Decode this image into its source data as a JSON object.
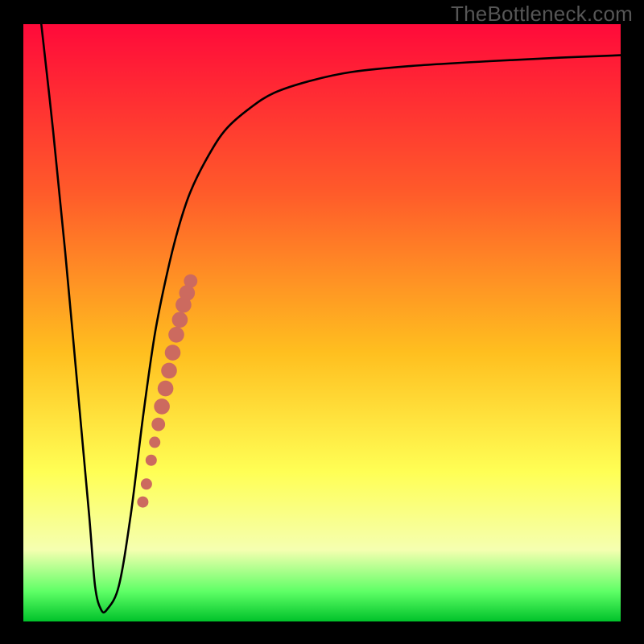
{
  "watermark": "TheBottleneck.com",
  "colors": {
    "top": "#ff0a3a",
    "mid_top": "#ff5a2a",
    "mid": "#ffbf1f",
    "mid_low": "#ffff55",
    "low": "#f5ffb0",
    "very_low": "#5eff66",
    "bottom_line": "#00c22a",
    "curve": "#000000",
    "markers": "#cc6a5f",
    "border": "#000000"
  },
  "chart_data": {
    "type": "line",
    "title": "",
    "xlabel": "",
    "ylabel": "",
    "xlim": [
      0,
      100
    ],
    "ylim": [
      0,
      100
    ],
    "series": [
      {
        "name": "bottleneck-curve",
        "x": [
          3,
          5,
          7,
          9,
          11,
          12,
          13,
          14,
          16,
          18,
          20,
          22,
          24,
          26,
          28,
          31,
          34,
          38,
          42,
          48,
          55,
          65,
          78,
          90,
          100
        ],
        "y": [
          100,
          82,
          62,
          40,
          18,
          6,
          2,
          2,
          6,
          18,
          34,
          48,
          58,
          66,
          72,
          78,
          82.5,
          86,
          88.5,
          90.5,
          92,
          93,
          93.8,
          94.4,
          94.8
        ]
      }
    ],
    "markers": {
      "name": "highlight-segment",
      "points": [
        {
          "x": 20.0,
          "y": 20.0,
          "r": 1.0
        },
        {
          "x": 20.6,
          "y": 23.0,
          "r": 1.0
        },
        {
          "x": 21.4,
          "y": 27.0,
          "r": 1.0
        },
        {
          "x": 22.0,
          "y": 30.0,
          "r": 1.0
        },
        {
          "x": 22.6,
          "y": 33.0,
          "r": 1.2
        },
        {
          "x": 23.2,
          "y": 36.0,
          "r": 1.4
        },
        {
          "x": 23.8,
          "y": 39.0,
          "r": 1.4
        },
        {
          "x": 24.4,
          "y": 42.0,
          "r": 1.4
        },
        {
          "x": 25.0,
          "y": 45.0,
          "r": 1.4
        },
        {
          "x": 25.6,
          "y": 48.0,
          "r": 1.4
        },
        {
          "x": 26.2,
          "y": 50.5,
          "r": 1.4
        },
        {
          "x": 26.8,
          "y": 53.0,
          "r": 1.4
        },
        {
          "x": 27.4,
          "y": 55.0,
          "r": 1.4
        },
        {
          "x": 28.0,
          "y": 57.0,
          "r": 1.2
        }
      ]
    },
    "gradient_bands": [
      {
        "y0": 100,
        "y1": 70,
        "c": "#ff0a3a"
      },
      {
        "y0": 70,
        "y1": 45,
        "c": "#ff8a1f"
      },
      {
        "y0": 45,
        "y1": 25,
        "c": "#ffe01f"
      },
      {
        "y0": 25,
        "y1": 12,
        "c": "#ffff70"
      },
      {
        "y0": 12,
        "y1": 6,
        "c": "#d8ff9a"
      },
      {
        "y0": 6,
        "y1": 3,
        "c": "#7eff7a"
      },
      {
        "y0": 3,
        "y1": 0,
        "c": "#00d23a"
      }
    ]
  }
}
